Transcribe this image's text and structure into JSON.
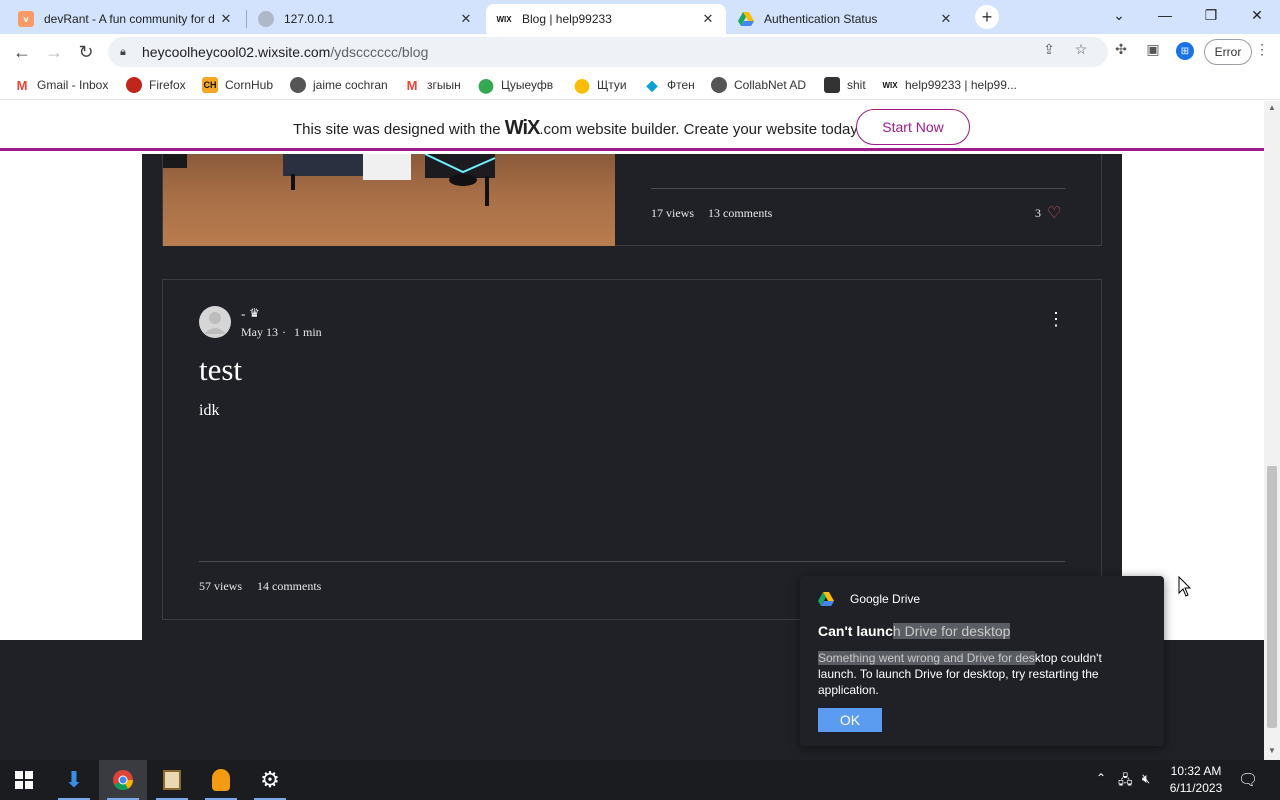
{
  "tabs": [
    {
      "title": "devRant - A fun community for d",
      "favicon": "devrant-icon"
    },
    {
      "title": "127.0.0.1",
      "favicon": "globe-icon"
    },
    {
      "title": "Blog | help99233",
      "favicon": "wix-icon",
      "favicon_text": "WIX"
    },
    {
      "title": "Authentication Status",
      "favicon": "google-drive-icon"
    }
  ],
  "toolbar": {
    "url_host": "heycoolheycool02.wixsite.com",
    "url_path": "/ydscccccc/blog",
    "error_label": "Error"
  },
  "bookmarks": [
    {
      "label": "Gmail - Inbox",
      "icon": "gmail-icon"
    },
    {
      "label": "Firefox",
      "icon": "firefox-icon"
    },
    {
      "label": "CornHub",
      "icon": "cornhub-icon",
      "icon_text": "CH"
    },
    {
      "label": "jaime cochran",
      "icon": "globe-icon"
    },
    {
      "label": "згыын",
      "icon": "gmail-icon"
    },
    {
      "label": "Цуыеуфв",
      "icon": "maps-pin-icon"
    },
    {
      "label": "Щтуи",
      "icon": "maps-pin-icon"
    },
    {
      "label": "Фтен",
      "icon": "diamond-icon"
    },
    {
      "label": "CollabNet AD",
      "icon": "globe-icon"
    },
    {
      "label": "shit",
      "icon": "app-icon"
    },
    {
      "label": "help99233 | help99...",
      "icon": "wix-icon",
      "icon_text": "WIX"
    }
  ],
  "wix_banner": {
    "text_before": "This site was designed with the ",
    "brand": "WiX",
    "brand_suffix": ".com",
    "text_after": " website builder. Create your website today.",
    "button": "Start Now"
  },
  "post1": {
    "views": "17 views",
    "comments": "13 comments",
    "likes": "3"
  },
  "post2": {
    "author": "-",
    "date": "May 13",
    "separator": "·",
    "read_time": "1 min",
    "title": "test",
    "excerpt": "idk",
    "views": "57 views",
    "comments": "14 comments"
  },
  "toast": {
    "app_name": "Google Drive",
    "title_plain": "Can't launc",
    "title_highlight": "h Drive for desktop",
    "body_highlight": "Something went wrong and Drive for des",
    "body_plain": "ktop couldn't launch. To launch Drive for desktop, try restarting the application.",
    "ok_label": "OK"
  },
  "taskbar": {
    "time": "10:32 AM",
    "date": "6/11/2023"
  },
  "colors": {
    "wix_accent": "#9c1a8a",
    "dark_bg": "#1f2126",
    "tabstrip": "#d3e3fd",
    "ok_button": "#5b9bf0",
    "like_heart": "#e05a5a"
  }
}
